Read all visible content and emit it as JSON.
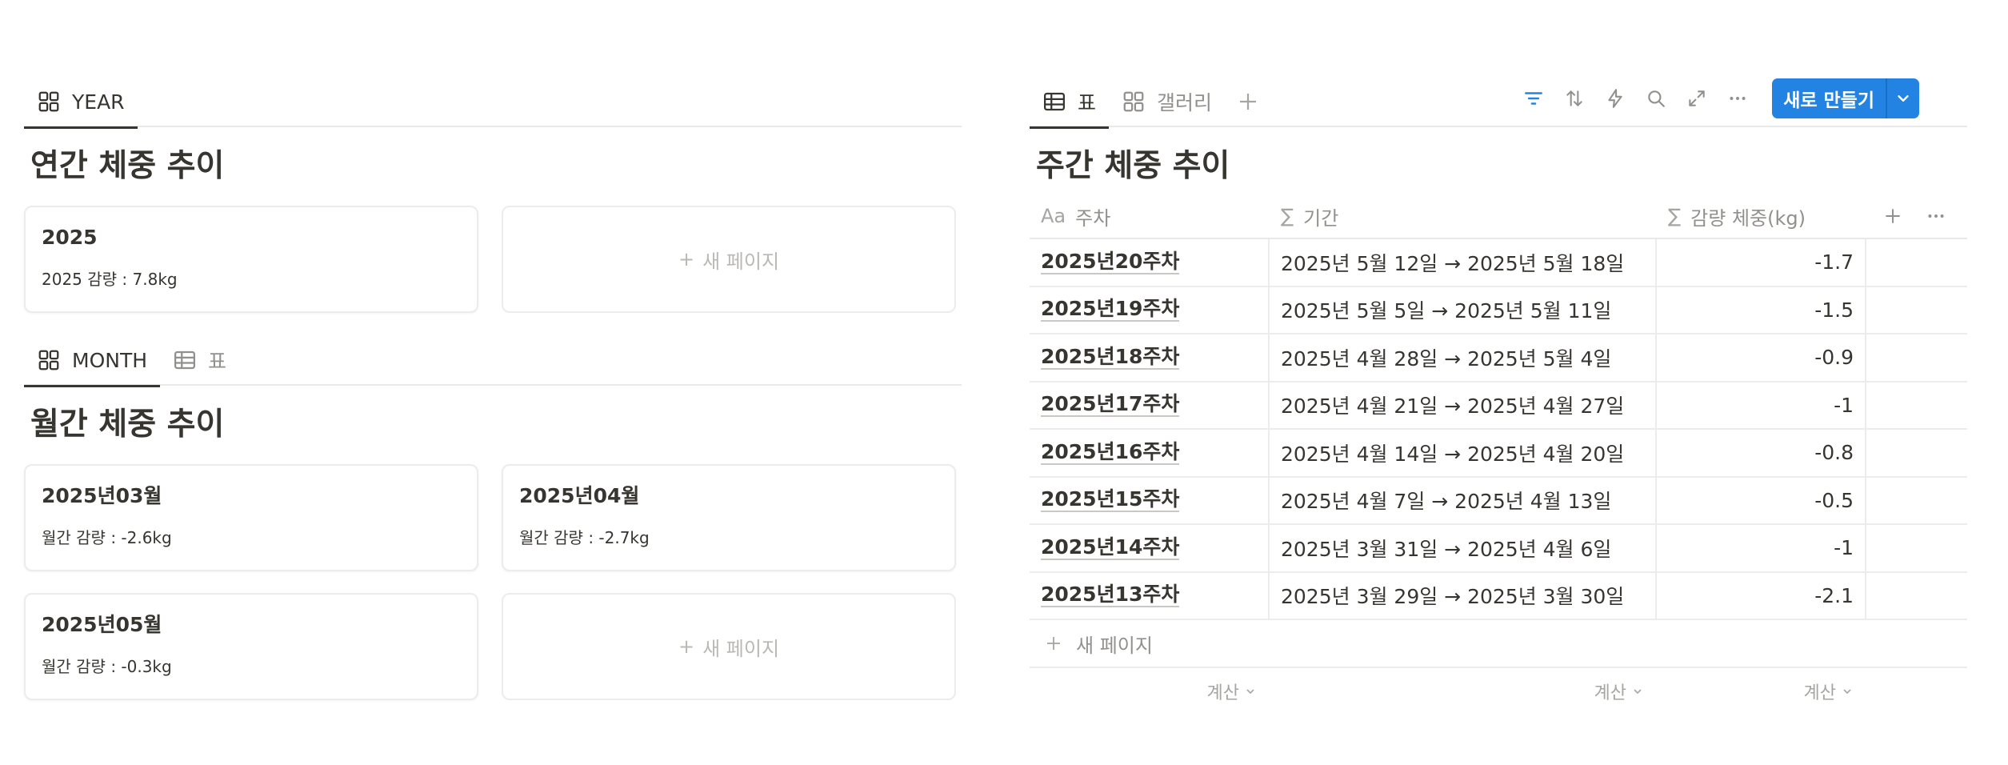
{
  "left": {
    "year_tab": {
      "label": "YEAR",
      "icon": "gallery-grid-icon"
    },
    "yearly_title": "연간 체중 추이",
    "year_cards": [
      {
        "title": "2025",
        "prop": "2025 감량 : 7.8kg"
      }
    ],
    "new_page_label": "새 페이지",
    "month_tabs": [
      {
        "label": "MONTH",
        "icon": "gallery-grid-icon"
      },
      {
        "label": "표",
        "icon": "table-icon"
      }
    ],
    "monthly_title": "월간 체중 추이",
    "month_cards": [
      {
        "title": "2025년03월",
        "prop": "월간 감량 : -2.6kg"
      },
      {
        "title": "2025년04월",
        "prop": "월간 감량 : -2.7kg"
      },
      {
        "title": "2025년05월",
        "prop": "월간 감량 : -0.3kg"
      }
    ]
  },
  "right": {
    "tabs": [
      {
        "label": "표",
        "icon": "table-icon"
      },
      {
        "label": "갤러리",
        "icon": "gallery-grid-icon"
      }
    ],
    "new_button_label": "새로 만들기",
    "title": "주간 체중 추이",
    "columns": [
      {
        "label": "주차",
        "type_icon": "Aa"
      },
      {
        "label": "기간",
        "type_icon": "∑"
      },
      {
        "label": "감량 체중(kg)",
        "type_icon": "∑"
      }
    ],
    "rows": [
      {
        "week": "2025년20주차",
        "period": "2025년 5월 12일 → 2025년 5월 18일",
        "loss": "-1.7"
      },
      {
        "week": "2025년19주차",
        "period": "2025년 5월 5일 → 2025년 5월 11일",
        "loss": "-1.5"
      },
      {
        "week": "2025년18주차",
        "period": "2025년 4월 28일 → 2025년 5월 4일",
        "loss": "-0.9"
      },
      {
        "week": "2025년17주차",
        "period": "2025년 4월 21일 → 2025년 4월 27일",
        "loss": "-1"
      },
      {
        "week": "2025년16주차",
        "period": "2025년 4월 14일 → 2025년 4월 20일",
        "loss": "-0.8"
      },
      {
        "week": "2025년15주차",
        "period": "2025년 4월 7일 → 2025년 4월 13일",
        "loss": "-0.5"
      },
      {
        "week": "2025년14주차",
        "period": "2025년 3월 31일 → 2025년 4월 6일",
        "loss": "-1"
      },
      {
        "week": "2025년13주차",
        "period": "2025년 3월 29일 → 2025년 3월 30일",
        "loss": "-2.1"
      }
    ],
    "new_page_label": "새 페이지",
    "calc_label": "계산"
  },
  "colors": {
    "accent": "#2383e2",
    "text": "#37352f",
    "muted": "#91908c",
    "border": "#e9e9e7"
  }
}
